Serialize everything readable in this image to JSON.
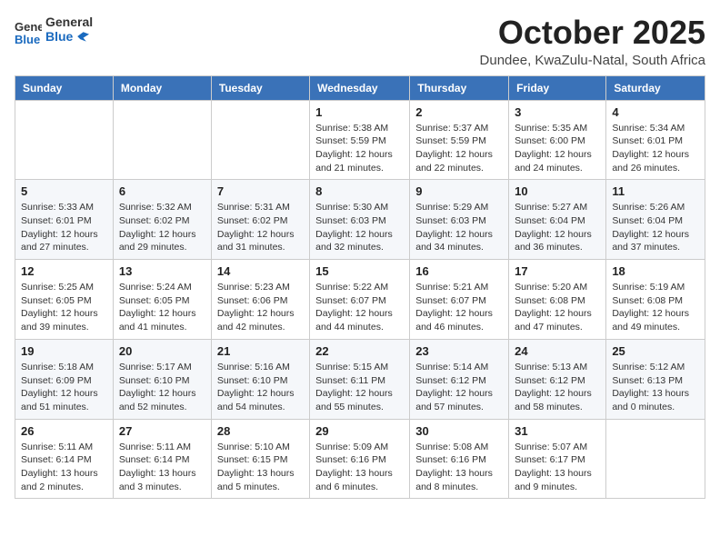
{
  "logo": {
    "general": "General",
    "blue": "Blue"
  },
  "header": {
    "month": "October 2025",
    "location": "Dundee, KwaZulu-Natal, South Africa"
  },
  "weekdays": [
    "Sunday",
    "Monday",
    "Tuesday",
    "Wednesday",
    "Thursday",
    "Friday",
    "Saturday"
  ],
  "weeks": [
    [
      {
        "day": "",
        "info": ""
      },
      {
        "day": "",
        "info": ""
      },
      {
        "day": "",
        "info": ""
      },
      {
        "day": "1",
        "info": "Sunrise: 5:38 AM\nSunset: 5:59 PM\nDaylight: 12 hours\nand 21 minutes."
      },
      {
        "day": "2",
        "info": "Sunrise: 5:37 AM\nSunset: 5:59 PM\nDaylight: 12 hours\nand 22 minutes."
      },
      {
        "day": "3",
        "info": "Sunrise: 5:35 AM\nSunset: 6:00 PM\nDaylight: 12 hours\nand 24 minutes."
      },
      {
        "day": "4",
        "info": "Sunrise: 5:34 AM\nSunset: 6:01 PM\nDaylight: 12 hours\nand 26 minutes."
      }
    ],
    [
      {
        "day": "5",
        "info": "Sunrise: 5:33 AM\nSunset: 6:01 PM\nDaylight: 12 hours\nand 27 minutes."
      },
      {
        "day": "6",
        "info": "Sunrise: 5:32 AM\nSunset: 6:02 PM\nDaylight: 12 hours\nand 29 minutes."
      },
      {
        "day": "7",
        "info": "Sunrise: 5:31 AM\nSunset: 6:02 PM\nDaylight: 12 hours\nand 31 minutes."
      },
      {
        "day": "8",
        "info": "Sunrise: 5:30 AM\nSunset: 6:03 PM\nDaylight: 12 hours\nand 32 minutes."
      },
      {
        "day": "9",
        "info": "Sunrise: 5:29 AM\nSunset: 6:03 PM\nDaylight: 12 hours\nand 34 minutes."
      },
      {
        "day": "10",
        "info": "Sunrise: 5:27 AM\nSunset: 6:04 PM\nDaylight: 12 hours\nand 36 minutes."
      },
      {
        "day": "11",
        "info": "Sunrise: 5:26 AM\nSunset: 6:04 PM\nDaylight: 12 hours\nand 37 minutes."
      }
    ],
    [
      {
        "day": "12",
        "info": "Sunrise: 5:25 AM\nSunset: 6:05 PM\nDaylight: 12 hours\nand 39 minutes."
      },
      {
        "day": "13",
        "info": "Sunrise: 5:24 AM\nSunset: 6:05 PM\nDaylight: 12 hours\nand 41 minutes."
      },
      {
        "day": "14",
        "info": "Sunrise: 5:23 AM\nSunset: 6:06 PM\nDaylight: 12 hours\nand 42 minutes."
      },
      {
        "day": "15",
        "info": "Sunrise: 5:22 AM\nSunset: 6:07 PM\nDaylight: 12 hours\nand 44 minutes."
      },
      {
        "day": "16",
        "info": "Sunrise: 5:21 AM\nSunset: 6:07 PM\nDaylight: 12 hours\nand 46 minutes."
      },
      {
        "day": "17",
        "info": "Sunrise: 5:20 AM\nSunset: 6:08 PM\nDaylight: 12 hours\nand 47 minutes."
      },
      {
        "day": "18",
        "info": "Sunrise: 5:19 AM\nSunset: 6:08 PM\nDaylight: 12 hours\nand 49 minutes."
      }
    ],
    [
      {
        "day": "19",
        "info": "Sunrise: 5:18 AM\nSunset: 6:09 PM\nDaylight: 12 hours\nand 51 minutes."
      },
      {
        "day": "20",
        "info": "Sunrise: 5:17 AM\nSunset: 6:10 PM\nDaylight: 12 hours\nand 52 minutes."
      },
      {
        "day": "21",
        "info": "Sunrise: 5:16 AM\nSunset: 6:10 PM\nDaylight: 12 hours\nand 54 minutes."
      },
      {
        "day": "22",
        "info": "Sunrise: 5:15 AM\nSunset: 6:11 PM\nDaylight: 12 hours\nand 55 minutes."
      },
      {
        "day": "23",
        "info": "Sunrise: 5:14 AM\nSunset: 6:12 PM\nDaylight: 12 hours\nand 57 minutes."
      },
      {
        "day": "24",
        "info": "Sunrise: 5:13 AM\nSunset: 6:12 PM\nDaylight: 12 hours\nand 58 minutes."
      },
      {
        "day": "25",
        "info": "Sunrise: 5:12 AM\nSunset: 6:13 PM\nDaylight: 13 hours\nand 0 minutes."
      }
    ],
    [
      {
        "day": "26",
        "info": "Sunrise: 5:11 AM\nSunset: 6:14 PM\nDaylight: 13 hours\nand 2 minutes."
      },
      {
        "day": "27",
        "info": "Sunrise: 5:11 AM\nSunset: 6:14 PM\nDaylight: 13 hours\nand 3 minutes."
      },
      {
        "day": "28",
        "info": "Sunrise: 5:10 AM\nSunset: 6:15 PM\nDaylight: 13 hours\nand 5 minutes."
      },
      {
        "day": "29",
        "info": "Sunrise: 5:09 AM\nSunset: 6:16 PM\nDaylight: 13 hours\nand 6 minutes."
      },
      {
        "day": "30",
        "info": "Sunrise: 5:08 AM\nSunset: 6:16 PM\nDaylight: 13 hours\nand 8 minutes."
      },
      {
        "day": "31",
        "info": "Sunrise: 5:07 AM\nSunset: 6:17 PM\nDaylight: 13 hours\nand 9 minutes."
      },
      {
        "day": "",
        "info": ""
      }
    ]
  ]
}
